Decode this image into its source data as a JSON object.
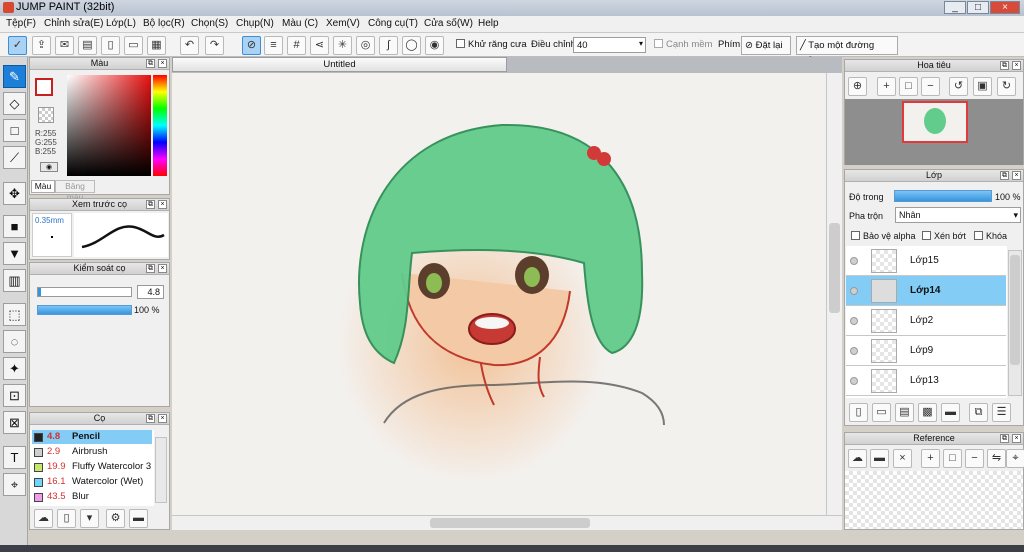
{
  "window": {
    "title": "JUMP PAINT (32bit)",
    "min": "_",
    "max": "□",
    "close": "×"
  },
  "menu": [
    "Tệp(F)",
    "Chỉnh sửa(E)",
    "Lớp(L)",
    "Bộ lọc(R)",
    "Chọn(S)",
    "Chụp(N)",
    "Màu (C)",
    "Xem(V)",
    "Công cụ(T)",
    "Cửa số(W)",
    "Help"
  ],
  "toolbar": {
    "antialias": "Khử răng cưa",
    "adjust_label": "Điều chỉnh",
    "adjust_value": "40",
    "edge": "Cạnh mềm",
    "keys": "Phím",
    "reset": "Đặt lại",
    "straight": "Tạo một đường thẳng"
  },
  "color_panel": {
    "title": "Màu",
    "r": "R:255",
    "g": "G:255",
    "b": "B:255",
    "tab_color": "Màu",
    "tab_swatch": "Bảng màu"
  },
  "preview_panel": {
    "title": "Xem trước cọ",
    "size": "0.35mm"
  },
  "control_panel": {
    "title": "Kiểm soát cọ",
    "size_value": "4.8",
    "opacity_value": "100 %"
  },
  "brush_panel": {
    "title": "Cọ",
    "items": [
      {
        "size": "4.8",
        "name": "Pencil",
        "color": "#222222"
      },
      {
        "size": "2.9",
        "name": "Airbrush",
        "color": "#cfcfcf"
      },
      {
        "size": "19.9",
        "name": "Fluffy Watercolor 3",
        "color": "#c6e86a"
      },
      {
        "size": "16.1",
        "name": "Watercolor (Wet)",
        "color": "#6fd6f6"
      },
      {
        "size": "43.5",
        "name": "Blur",
        "color": "#f19ce6"
      }
    ]
  },
  "canvas": {
    "tab": "Untitled"
  },
  "navigator": {
    "title": "Hoa tiêu"
  },
  "layer_panel": {
    "title": "Lớp",
    "opacity_label": "Độ trong",
    "opacity_value": "100 %",
    "blend_label": "Pha trộn",
    "blend_value": "Nhân",
    "protect_alpha": "Bảo vệ alpha",
    "clip": "Xén bớt",
    "lock": "Khóa",
    "layers": [
      {
        "name": "Lớp15"
      },
      {
        "name": "Lớp14"
      },
      {
        "name": "Lớp2"
      },
      {
        "name": "Lớp9"
      },
      {
        "name": "Lớp13"
      }
    ]
  },
  "reference_panel": {
    "title": "Reference"
  },
  "colors": {
    "accent": "#3795de",
    "selection": "#83ccf5"
  }
}
